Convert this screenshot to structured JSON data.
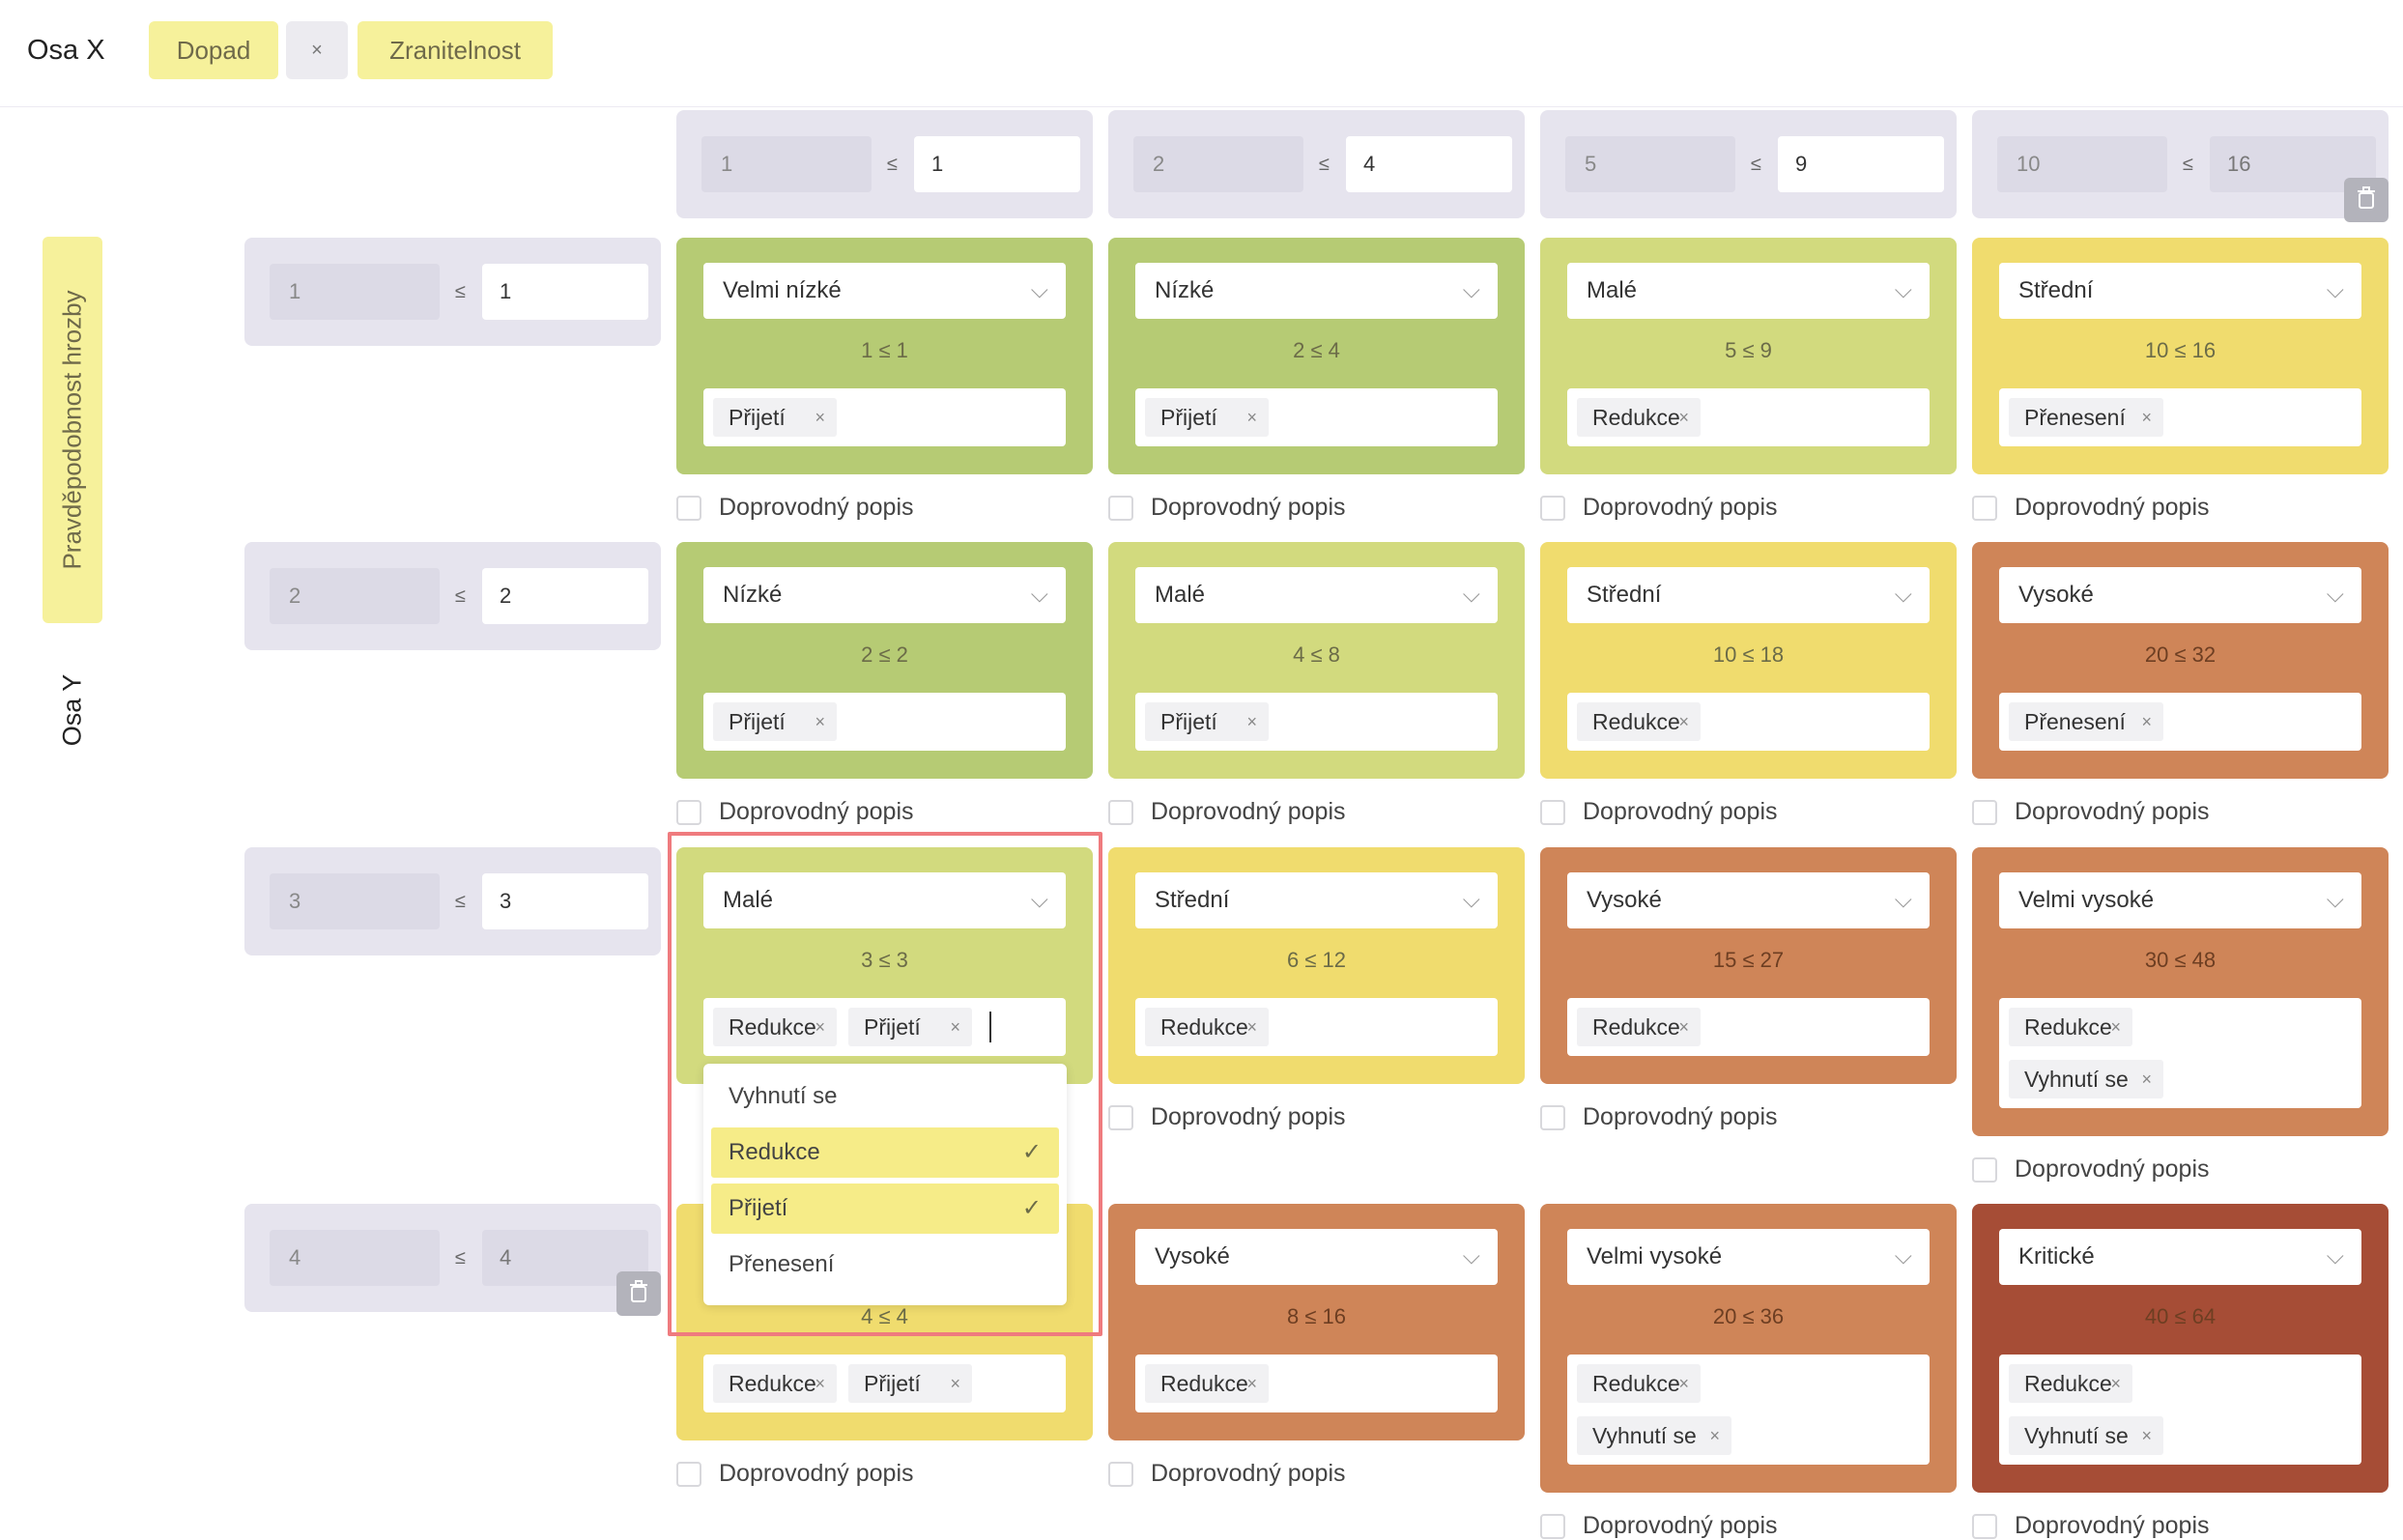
{
  "header": {
    "x_axis_label": "Osa X",
    "chips": [
      {
        "label": "Dopad",
        "kind": "yellow"
      },
      {
        "label": "×",
        "kind": "grey"
      },
      {
        "label": "Zranitelnost",
        "kind": "yellow"
      }
    ]
  },
  "y_axis": {
    "chip_label": "Pravděpodobnost hrozby",
    "axis_label": "Osa Y"
  },
  "le_symbol": "≤",
  "description_label": "Doprovodný popis",
  "columns": [
    {
      "lo": "1",
      "hi": "1"
    },
    {
      "lo": "2",
      "hi": "4"
    },
    {
      "lo": "5",
      "hi": "9"
    },
    {
      "lo": "10",
      "hi": "16"
    }
  ],
  "rows": [
    {
      "lo": "1",
      "hi": "1"
    },
    {
      "lo": "2",
      "hi": "2"
    },
    {
      "lo": "3",
      "hi": "3"
    },
    {
      "lo": "4",
      "hi": "4"
    }
  ],
  "cells": [
    [
      {
        "level": "Velmi nízké",
        "formula": "1 ≤ 1",
        "color": "#b6cb74",
        "tags": [
          "Přijetí"
        ]
      },
      {
        "level": "Nízké",
        "formula": "2 ≤ 4",
        "color": "#b6cb74",
        "tags": [
          "Přijetí"
        ]
      },
      {
        "level": "Malé",
        "formula": "5 ≤ 9",
        "color": "#d2da7e",
        "tags": [
          "Redukce"
        ]
      },
      {
        "level": "Střední",
        "formula": "10 ≤ 16",
        "color": "#f0dc6e",
        "tags": [
          "Přenesení"
        ]
      }
    ],
    [
      {
        "level": "Nízké",
        "formula": "2 ≤ 2",
        "color": "#b6cb74",
        "tags": [
          "Přijetí"
        ]
      },
      {
        "level": "Malé",
        "formula": "4 ≤ 8",
        "color": "#d2da7e",
        "tags": [
          "Přijetí"
        ]
      },
      {
        "level": "Střední",
        "formula": "10 ≤ 18",
        "color": "#f0dc6e",
        "tags": [
          "Redukce"
        ]
      },
      {
        "level": "Vysoké",
        "formula": "20 ≤ 32",
        "color": "#cf8558",
        "tags": [
          "Přenesení"
        ]
      }
    ],
    [
      {
        "level": "Malé",
        "formula": "3 ≤ 3",
        "color": "#d2da7e",
        "tags": [
          "Redukce",
          "Přijetí"
        ]
      },
      {
        "level": "Střední",
        "formula": "6 ≤ 12",
        "color": "#f0dc6e",
        "tags": [
          "Redukce"
        ]
      },
      {
        "level": "Vysoké",
        "formula": "15 ≤ 27",
        "color": "#cf8558",
        "tags": [
          "Redukce"
        ]
      },
      {
        "level": "Velmi vysoké",
        "formula": "30 ≤ 48",
        "color": "#cf8558",
        "tags": [
          "Redukce",
          "Vyhnutí se"
        ]
      }
    ],
    [
      {
        "level": "",
        "formula": "4 ≤ 4",
        "color": "#f0dc6e",
        "tags": [
          "Redukce",
          "Přijetí"
        ]
      },
      {
        "level": "Vysoké",
        "formula": "8 ≤ 16",
        "color": "#cf8558",
        "tags": [
          "Redukce"
        ]
      },
      {
        "level": "Velmi vysoké",
        "formula": "20 ≤ 36",
        "color": "#cf8558",
        "tags": [
          "Redukce",
          "Vyhnutí se"
        ]
      },
      {
        "level": "Kritické",
        "formula": "40 ≤ 64",
        "color": "#a64d36",
        "tags": [
          "Redukce",
          "Vyhnutí se"
        ]
      }
    ]
  ],
  "dropdown": {
    "options": [
      {
        "label": "Vyhnutí se",
        "selected": false
      },
      {
        "label": "Redukce",
        "selected": true
      },
      {
        "label": "Přijetí",
        "selected": true
      },
      {
        "label": "Přenesení",
        "selected": false
      }
    ]
  },
  "colors": {
    "chip_yellow": "#f6f19b",
    "green": "#b6cb74",
    "lime": "#d2da7e",
    "yellow": "#f0dc6e",
    "orange": "#cf8558",
    "red": "#a64d36",
    "highlight": "#ef7b7e"
  }
}
